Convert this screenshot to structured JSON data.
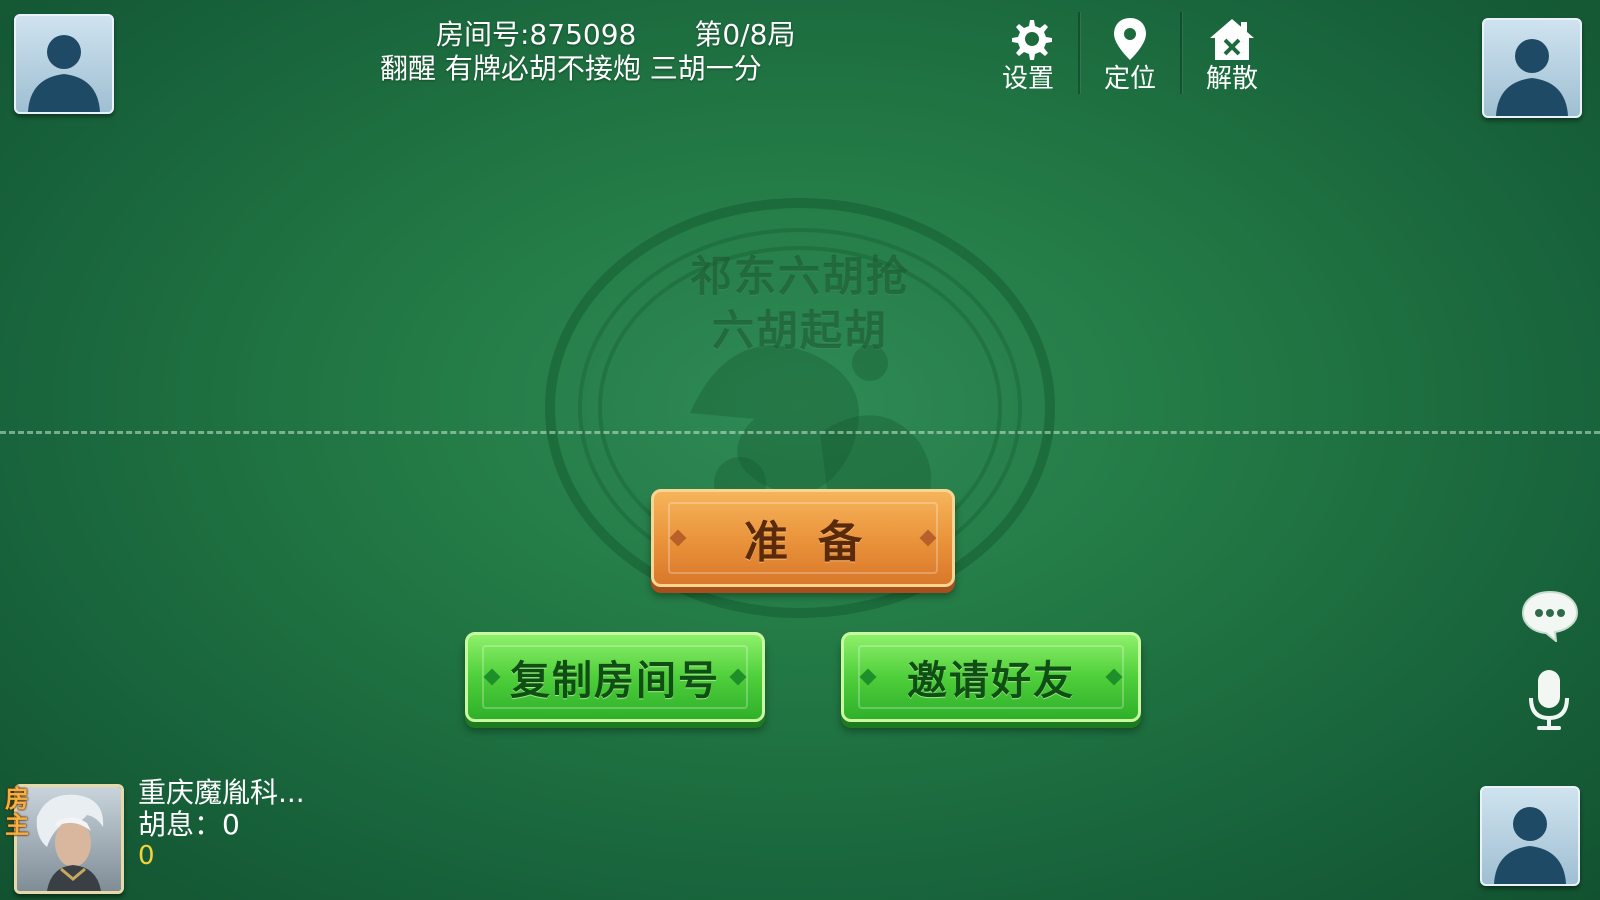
{
  "header": {
    "room_number": "房间号:875098",
    "round": "第0/8局",
    "rules": "翻醒  有牌必胡不接炮  三胡一分"
  },
  "toolbar": {
    "settings_label": "设置",
    "location_label": "定位",
    "dissolve_label": "解散"
  },
  "table": {
    "watermark_line1": "祁东六胡抢",
    "watermark_line2": "六胡起胡",
    "felt_color": "#237a45"
  },
  "actions": {
    "ready_label": "准备",
    "copy_room_label": "复制房间号",
    "invite_label": "邀请好友"
  },
  "player": {
    "host_badge": "房主",
    "name": "重庆魔胤科...",
    "hu_score": "胡息：0",
    "score": "0"
  },
  "side": {
    "chat_icon": "chat-bubble-icon",
    "voice_icon": "microphone-icon"
  }
}
